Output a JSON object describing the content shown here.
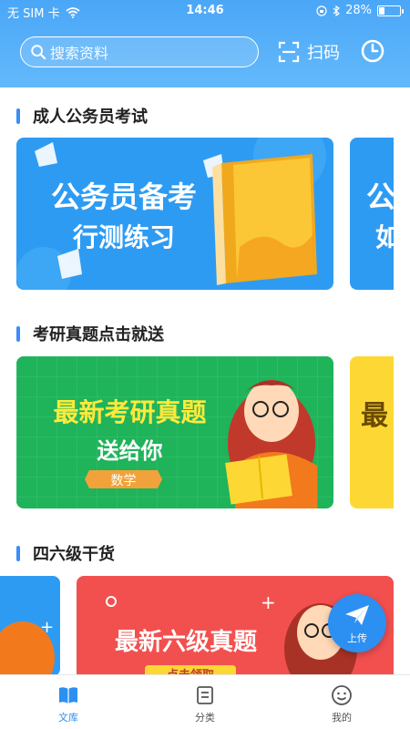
{
  "status": {
    "carrier": "无 SIM 卡",
    "time": "14:46",
    "battery": "28%",
    "battery_level": 0.28
  },
  "header": {
    "search_placeholder": "搜索资料",
    "scan_label": "扫码",
    "icons": {
      "search": "search-icon",
      "scan": "scan-icon",
      "history": "clock-icon"
    }
  },
  "sections": [
    {
      "title": "成人公务员考试",
      "cards": [
        {
          "line1": "公务员备考",
          "line2": "行测练习"
        },
        {
          "line1": "公",
          "line2": "如"
        }
      ]
    },
    {
      "title": "考研真题点击就送",
      "cards": [
        {
          "line1": "最新考研真题",
          "line2": "送给你",
          "tag": "数学"
        },
        {
          "line1": "最"
        }
      ]
    },
    {
      "title": "四六级干货",
      "cards": [
        {
          "line1": "最新六级真题",
          "line2": "点击领取"
        }
      ]
    }
  ],
  "fab": {
    "label": "上传",
    "icon": "paper-plane-icon"
  },
  "tabs": [
    {
      "label": "文库",
      "icon": "book-icon",
      "active": true
    },
    {
      "label": "分类",
      "icon": "list-icon",
      "active": false
    },
    {
      "label": "我的",
      "icon": "smile-icon",
      "active": false
    }
  ],
  "colors": {
    "header": "#4aa6f7",
    "accent": "#2c8ff2",
    "card_blue": "#2e9bf3",
    "card_green": "#1fb35a",
    "card_red": "#f2504f"
  }
}
